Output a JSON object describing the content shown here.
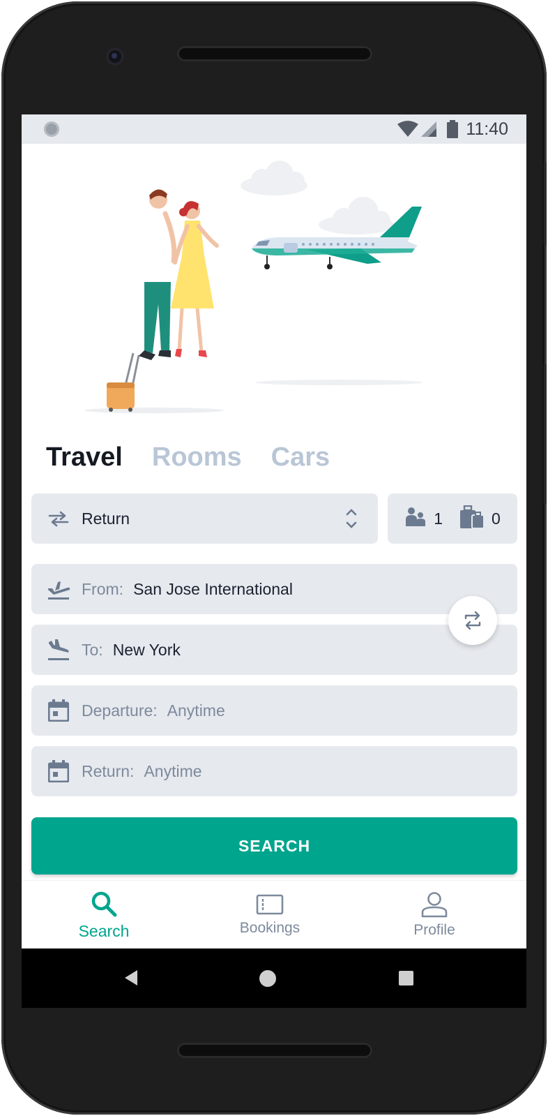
{
  "status_bar": {
    "time": "11:40"
  },
  "tabs": [
    {
      "label": "Travel",
      "active": true
    },
    {
      "label": "Rooms",
      "active": false
    },
    {
      "label": "Cars",
      "active": false
    }
  ],
  "trip_type": {
    "value": "Return",
    "icon": "swap-horizontal-icon"
  },
  "passengers": {
    "people": "1",
    "bags": "0"
  },
  "from": {
    "label": "From:",
    "value": "San Jose International",
    "icon": "flight-takeoff-icon"
  },
  "to": {
    "label": "To:",
    "value": "New York",
    "icon": "flight-land-icon"
  },
  "departure": {
    "label": "Departure:",
    "value": "Anytime",
    "icon": "calendar-icon"
  },
  "return": {
    "label": "Return:",
    "value": "Anytime",
    "icon": "calendar-icon"
  },
  "search_button": {
    "label": "SEARCH"
  },
  "bottom_nav": [
    {
      "label": "Search",
      "icon": "search-icon",
      "active": true
    },
    {
      "label": "Bookings",
      "icon": "ticket-icon",
      "active": false
    },
    {
      "label": "Profile",
      "icon": "person-icon",
      "active": false
    }
  ],
  "colors": {
    "accent": "#00a58e",
    "field_bg": "#e6e9ee",
    "muted_text": "#7d8a9c",
    "inactive_tab": "#b9c6d6"
  }
}
